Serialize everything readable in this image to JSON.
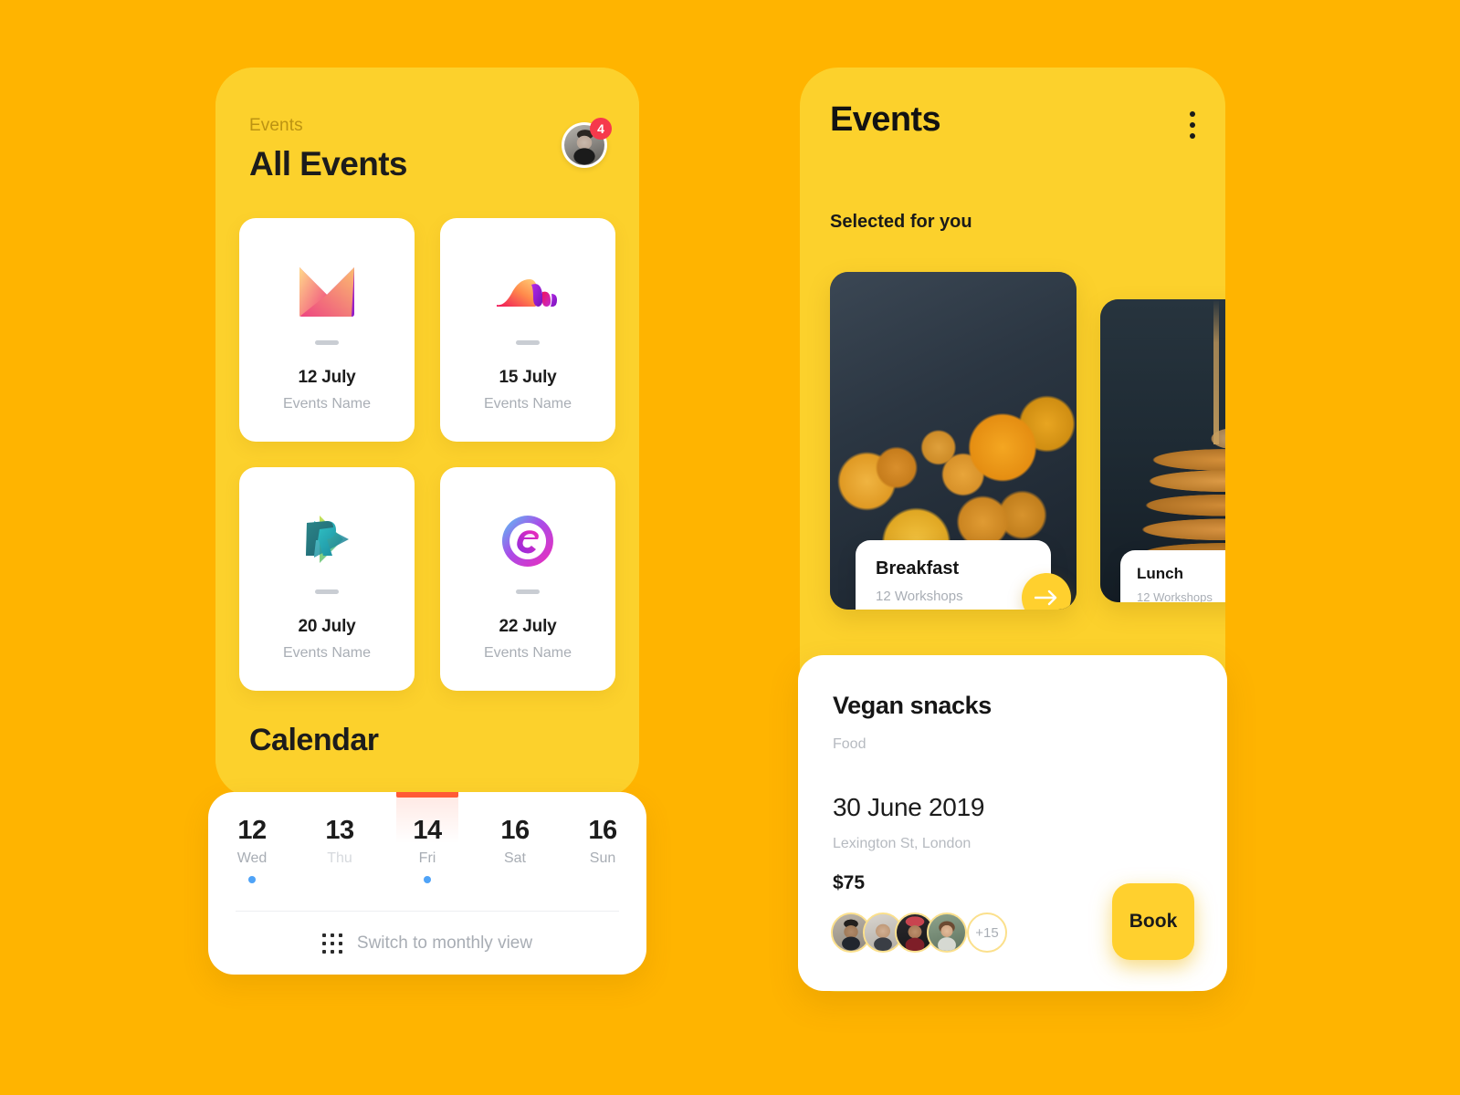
{
  "theme": {
    "page_bg": "#FFB400",
    "phone_bg": "#FCD12C",
    "accent_yellow": "#FFD02E",
    "badge_red": "#F6394C",
    "active_day": "#FF5A36",
    "event_dot_blue": "#4FA3F7"
  },
  "left_screen": {
    "eyebrow": "Events",
    "title": "All Events",
    "avatar_badge": "4",
    "cards": [
      {
        "date": "12 July",
        "name": "Events Name",
        "logo": "envelope-gradient-logo"
      },
      {
        "date": "15 July",
        "name": "Events Name",
        "logo": "wave-gradient-logo"
      },
      {
        "date": "20 July",
        "name": "Events Name",
        "logo": "r-play-logo"
      },
      {
        "date": "22 July",
        "name": "Events Name",
        "logo": "e-circle-logo"
      }
    ],
    "calendar": {
      "heading": "Calendar",
      "days": [
        {
          "num": "12",
          "name": "Wed",
          "active": false,
          "dim": false,
          "has_event": true
        },
        {
          "num": "13",
          "name": "Thu",
          "active": false,
          "dim": true,
          "has_event": false
        },
        {
          "num": "14",
          "name": "Fri",
          "active": true,
          "dim": false,
          "has_event": true
        },
        {
          "num": "16",
          "name": "Sat",
          "active": false,
          "dim": false,
          "has_event": false
        },
        {
          "num": "16",
          "name": "Sun",
          "active": false,
          "dim": false,
          "has_event": false
        }
      ],
      "switch_label": "Switch to monthly view"
    }
  },
  "right_screen": {
    "title": "Events",
    "menu_icon": "kebab-menu-icon",
    "section_label": "Selected for you",
    "carousel": [
      {
        "title": "Breakfast",
        "subtitle": "12 Workshops",
        "image": "spiced-oranges-photo"
      },
      {
        "title": "Lunch",
        "subtitle": "12 Workshops",
        "image": "pancakes-syrup-photo"
      }
    ],
    "detail": {
      "title": "Vegan snacks",
      "category": "Food",
      "date": "30 June 2019",
      "location": "Lexington St, London",
      "price": "$75",
      "attendees_more": "+15",
      "book_label": "Book"
    }
  }
}
